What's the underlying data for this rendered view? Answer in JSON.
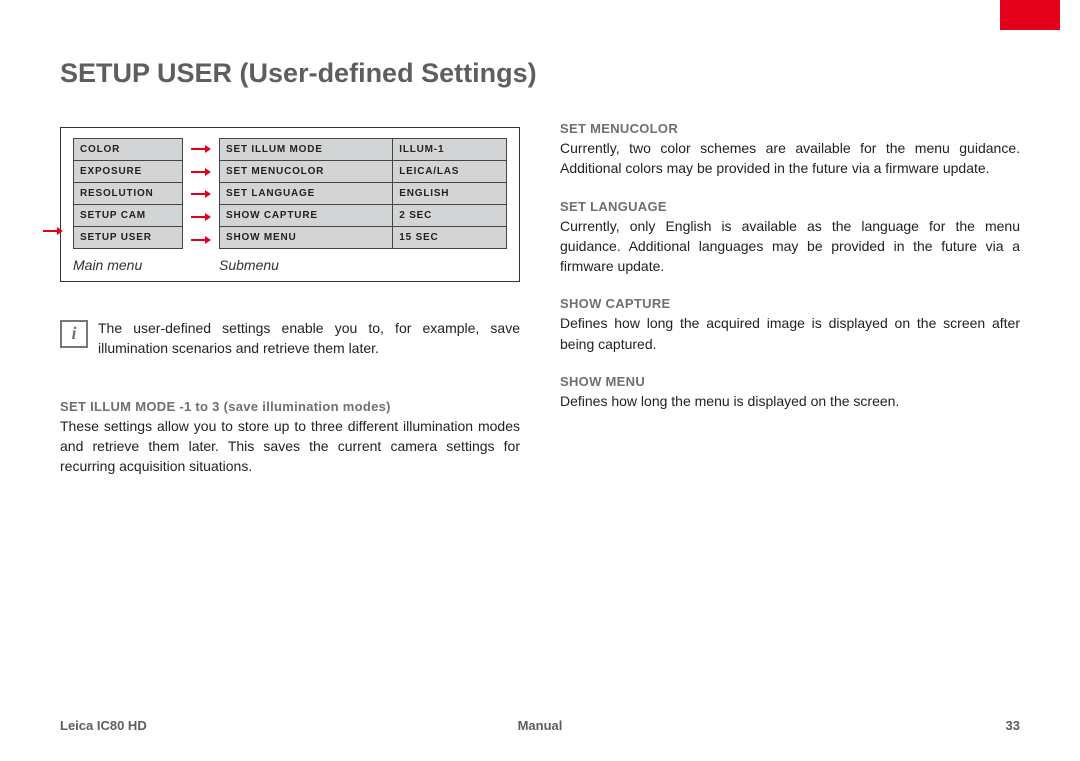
{
  "header": {
    "title": "SETUP USER (User-defined Settings)"
  },
  "menu": {
    "main_items": [
      "COLOR",
      "EXPOSURE",
      "RESOLUTION",
      "SETUP CAM",
      "SETUP USER"
    ],
    "active_main_index": 4,
    "sub_items": [
      {
        "label": "SET ILLUM MODE",
        "value": "ILLUM-1"
      },
      {
        "label": "SET MENUCOLOR",
        "value": "LEICA/LAS"
      },
      {
        "label": "SET LANGUAGE",
        "value": "ENGLISH"
      },
      {
        "label": "SHOW CAPTURE",
        "value": "2 SEC"
      },
      {
        "label": "SHOW MENU",
        "value": "15 SEC"
      }
    ],
    "main_label": "Main menu",
    "sub_label": "Submenu"
  },
  "info_text": "The user-defined settings enable you to, for example, save illumination scenarios and retrieve them later.",
  "left_sections": [
    {
      "heading": "SET ILLUM MODE -1 to 3 (save illumination modes)",
      "body": "These settings allow you to store up to three different illumination modes and retrieve them later. This saves the current camera settings for recurring acquisition situations."
    }
  ],
  "right_sections": [
    {
      "heading": "SET MENUCOLOR",
      "body": "Currently, two color schemes are available for the menu guidance. Additional colors may be provided in the future via a firmware update."
    },
    {
      "heading": "SET LANGUAGE",
      "body": "Currently, only English is available as the language for the menu guidance. Additional languages may be provided in the future via a firmware update."
    },
    {
      "heading": "SHOW CAPTURE",
      "body": "Defines how long the acquired image is displayed on the screen after being captured."
    },
    {
      "heading": "SHOW MENU",
      "body": "Defines how long the menu is displayed on the screen."
    }
  ],
  "footer": {
    "left": "Leica IC80 HD",
    "center": "Manual",
    "right": "33"
  }
}
